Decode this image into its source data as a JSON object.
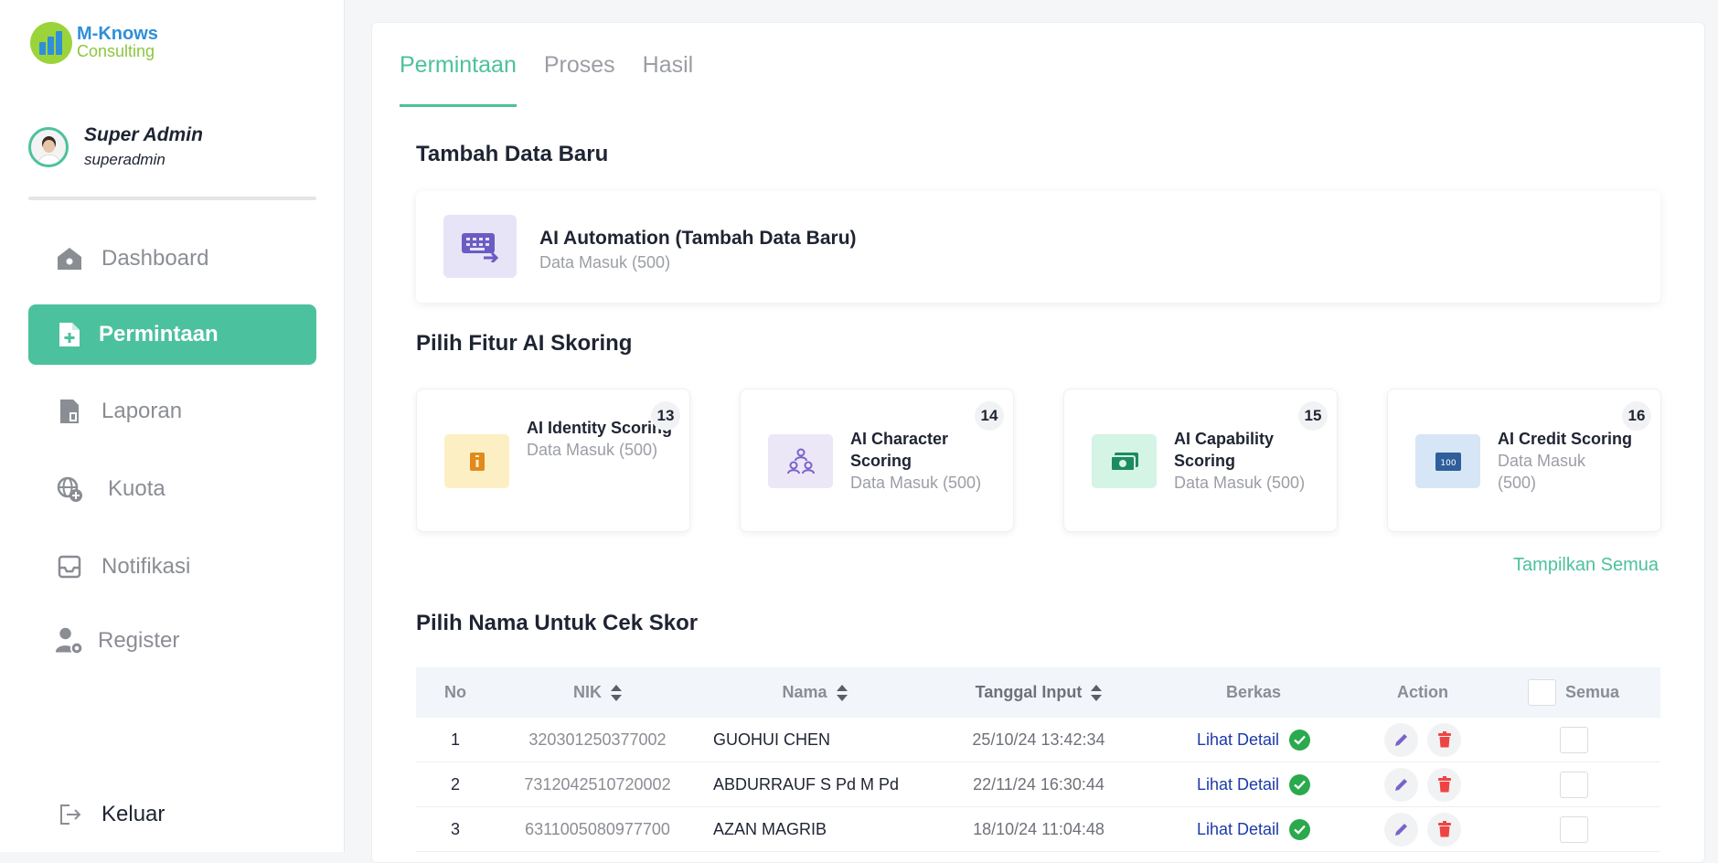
{
  "brand": {
    "line1": "M-Knows",
    "line2": "Consulting"
  },
  "profile": {
    "name": "Super Admin",
    "username": "superadmin"
  },
  "sidebar": {
    "items": [
      {
        "label": "Dashboard",
        "icon": "home-icon",
        "active": false
      },
      {
        "label": "Permintaan",
        "icon": "file-plus-icon",
        "active": true
      },
      {
        "label": "Laporan",
        "icon": "report-icon",
        "active": false
      },
      {
        "label": "Kuota",
        "icon": "globe-plus-icon",
        "active": false
      },
      {
        "label": "Notifikasi",
        "icon": "inbox-icon",
        "active": false
      },
      {
        "label": "Register",
        "icon": "user-gear-icon",
        "active": false
      }
    ],
    "logout": {
      "label": "Keluar",
      "icon": "logout-icon"
    }
  },
  "tabs": [
    {
      "label": "Permintaan",
      "active": true
    },
    {
      "label": "Proses",
      "active": false
    },
    {
      "label": "Hasil",
      "active": false
    }
  ],
  "add_section": {
    "title": "Tambah Data Baru",
    "card": {
      "title": "AI Automation (Tambah Data Baru)",
      "subtitle": "Data Masuk (500)",
      "icon": "keyboard-arrow-icon"
    }
  },
  "features_section": {
    "title": "Pilih Fitur AI Skoring",
    "cards": [
      {
        "title": "AI Identity Scoring",
        "subtitle": "Data Masuk (500)",
        "badge": "13",
        "icon": "id-card-icon",
        "color": "#fdefc4",
        "icon_color": "#e08a1e"
      },
      {
        "title": "AI Character Scoring",
        "subtitle": "Data Masuk (500)",
        "badge": "14",
        "icon": "people-network-icon",
        "color": "#ebe7f6",
        "icon_color": "#7a63c9"
      },
      {
        "title": "AI Capability Scoring",
        "subtitle": "Data Masuk (500)",
        "badge": "15",
        "icon": "money-icon",
        "color": "#d4f4e6",
        "icon_color": "#1d8a5f"
      },
      {
        "title": "AI Credit Scoring",
        "subtitle": "Data Masuk (500)",
        "badge": "16",
        "icon": "score-100-icon",
        "color": "#d6e6f6",
        "icon_color": "#2f5f9a"
      }
    ],
    "show_all": "Tampilkan Semua"
  },
  "table_section": {
    "title": "Pilih Nama Untuk Cek Skor",
    "headers": {
      "no": "No",
      "nik": "NIK",
      "nama": "Nama",
      "tanggal": "Tanggal Input",
      "berkas": "Berkas",
      "action": "Action",
      "semua": "Semua"
    },
    "rows": [
      {
        "no": "1",
        "nik": "320301250377002",
        "nama": "GUOHUI CHEN",
        "tanggal": "25/10/24 13:42:34",
        "berkas": "Lihat Detail"
      },
      {
        "no": "2",
        "nik": "7312042510720002",
        "nama": "ABDURRAUF S Pd M Pd",
        "tanggal": "22/11/24 16:30:44",
        "berkas": "Lihat Detail"
      },
      {
        "no": "3",
        "nik": "6311005080977700",
        "nama": "AZAN MAGRIB",
        "tanggal": "18/10/24 11:04:48",
        "berkas": "Lihat Detail"
      }
    ]
  },
  "colors": {
    "accent": "#4cc19d",
    "link": "#1c3aa9",
    "danger": "#ef4444",
    "success": "#2aa94f",
    "edit": "#7a63c9"
  }
}
